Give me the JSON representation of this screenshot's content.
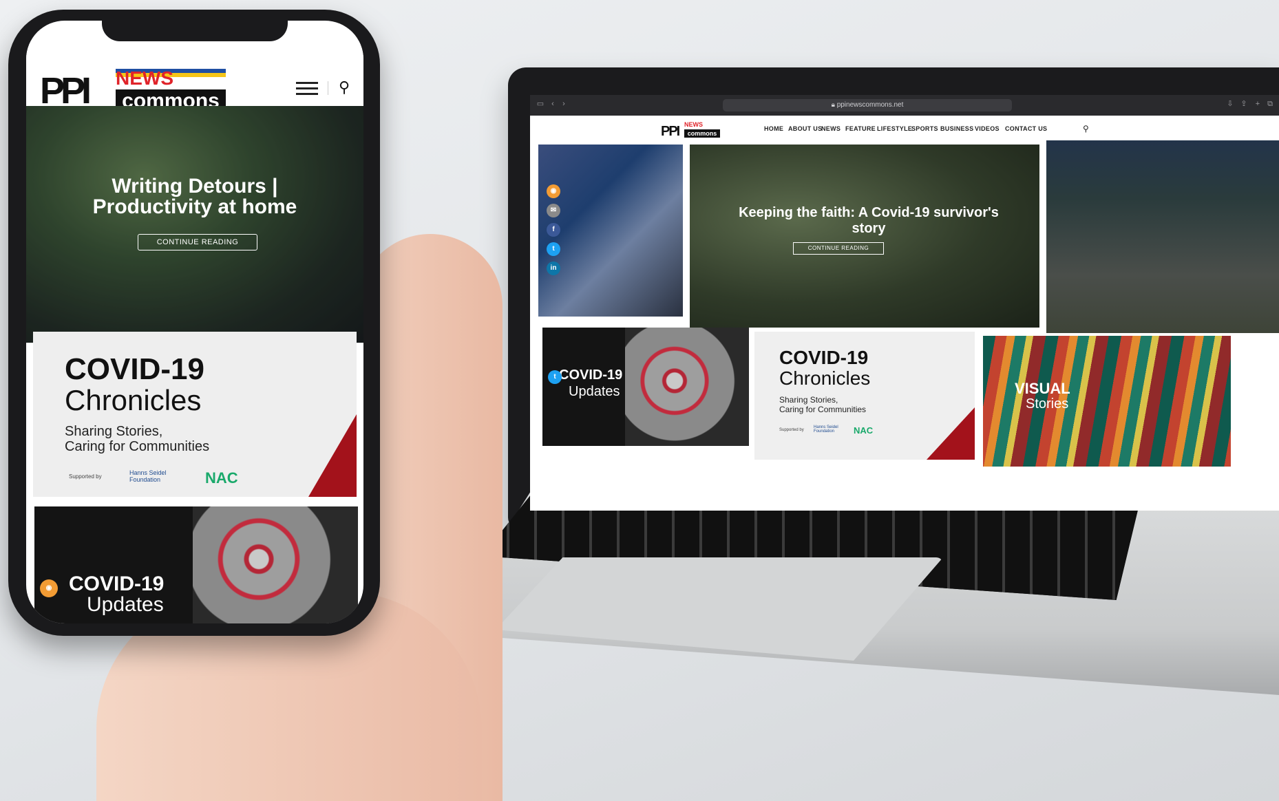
{
  "laptop": {
    "url": "ppinewscommons.net",
    "logo": {
      "line1": "NEWS",
      "line2": "commons",
      "mark": "PPI"
    },
    "nav": [
      "HOME",
      "ABOUT US",
      "NEWS",
      "FEATURE",
      "LIFESTYLE",
      "SPORTS",
      "BUSINESS",
      "VIDEOS",
      "CONTACT US"
    ],
    "hero": {
      "title": "Keeping the faith: A Covid-19 survivor's story",
      "cta": "CONTINUE READING"
    },
    "share_icons": [
      "rss-icon",
      "email-icon",
      "facebook-icon",
      "twitter-icon",
      "linkedin-icon"
    ],
    "cards": {
      "covid": {
        "line1": "COVID-19",
        "line2": "Updates"
      },
      "chronicles": {
        "title1": "COVID-19",
        "title2": "Chronicles",
        "tagline1": "Sharing Stories,",
        "tagline2": "Caring for Communities",
        "supported_by": "Supported by",
        "sponsor1": "Hanns Seidel Foundation",
        "sponsor2": "NAC"
      },
      "visual": {
        "line1": "VISUAL",
        "line2": "Stories"
      }
    }
  },
  "phone": {
    "logo": {
      "line1": "NEWS",
      "line2": "commons",
      "mark": "PPI"
    },
    "hero": {
      "title_line1": "Writing Detours |",
      "title_line2": "Productivity at home",
      "cta": "CONTINUE READING"
    },
    "chronicles": {
      "title1": "COVID-19",
      "title2": "Chronicles",
      "tagline1": "Sharing Stories,",
      "tagline2": "Caring for Communities",
      "supported_by": "Supported by",
      "sponsor1": "Hanns Seidel Foundation",
      "sponsor2": "NAC"
    },
    "covid": {
      "line1": "COVID-19",
      "line2": "Updates"
    }
  },
  "colors": {
    "news_red": "#e0242a",
    "accent_orange": "#f4a23b",
    "rss": "#f39c34",
    "email": "#8a8a8a",
    "facebook": "#3b5998",
    "twitter": "#1da1f2",
    "linkedin": "#0e76a8",
    "nac_green": "#1aa96b"
  }
}
